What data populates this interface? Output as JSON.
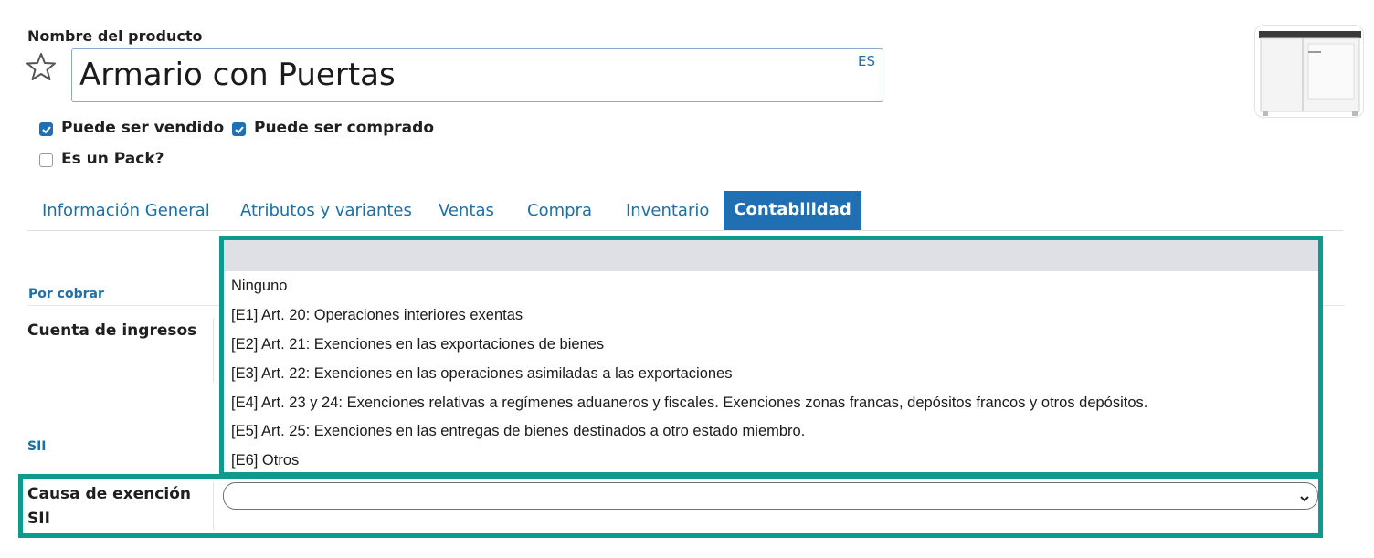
{
  "product": {
    "name_label": "Nombre del producto",
    "name_value": "Armario con Puertas",
    "lang_tag": "ES",
    "favorite_icon": "star-outline-icon",
    "image_alt": "cabinet-photo"
  },
  "checkboxes": [
    {
      "label": "Puede ser vendido",
      "checked": true
    },
    {
      "label": "Puede ser comprado",
      "checked": true
    },
    {
      "label": "Es un Pack?",
      "checked": false
    }
  ],
  "tabs": [
    {
      "label": "Información General"
    },
    {
      "label": "Atributos y variantes"
    },
    {
      "label": "Ventas"
    },
    {
      "label": "Compra"
    },
    {
      "label": "Inventario"
    },
    {
      "label": "Contabilidad",
      "active": true
    }
  ],
  "sections": {
    "receivable": "Por cobrar",
    "sii": "SII"
  },
  "fields": {
    "income_account_label": "Cuenta de ingresos",
    "exemption_label_line1": "Causa de exención",
    "exemption_label_line2": "SII",
    "exemption_value": ""
  },
  "dropdown": {
    "options": [
      "Ninguno",
      "[E1] Art. 20: Operaciones interiores exentas",
      "[E2] Art. 21: Exenciones en las exportaciones de bienes",
      "[E3] Art. 22: Exenciones en las operaciones asimiladas a las exportaciones",
      "[E4] Art. 23 y 24: Exenciones relativas a regímenes aduaneros y fiscales. Exenciones zonas francas, depósitos francos y otros depósitos.",
      "[E5] Art. 25: Exenciones en las entregas de bienes destinados a otro estado miembro.",
      "[E6] Otros"
    ]
  },
  "colors": {
    "accent": "#1f6fb2",
    "link": "#1e6fa6",
    "highlight": "#0d9a8f"
  }
}
